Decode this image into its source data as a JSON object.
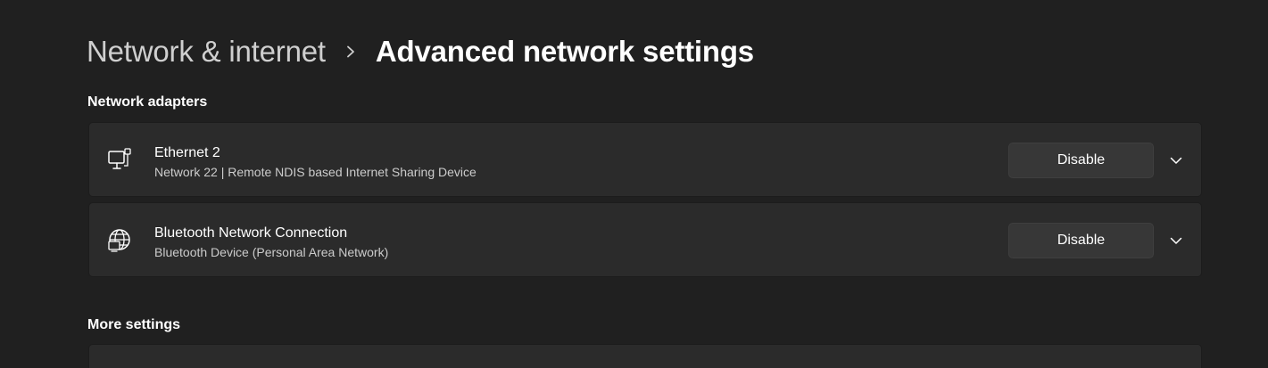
{
  "breadcrumb": {
    "parent": "Network & internet",
    "current": "Advanced network settings",
    "separator_icon": "chevron-right-icon"
  },
  "sections": {
    "adapters_title": "Network adapters",
    "more_title": "More settings"
  },
  "adapters": [
    {
      "icon": "ethernet-icon",
      "name": "Ethernet 2",
      "description": "Network 22 | Remote NDIS based Internet Sharing Device",
      "button_label": "Disable",
      "expand_icon": "chevron-down-icon"
    },
    {
      "icon": "bluetooth-network-globe-icon",
      "name": "Bluetooth Network Connection",
      "description": "Bluetooth Device (Personal Area Network)",
      "button_label": "Disable",
      "expand_icon": "chevron-down-icon"
    }
  ],
  "colors": {
    "background": "#202020",
    "card": "#2b2b2b",
    "button": "#373737",
    "text_primary": "#ffffff",
    "text_secondary": "#cccccc",
    "breadcrumb_parent": "#cfcfcf"
  }
}
